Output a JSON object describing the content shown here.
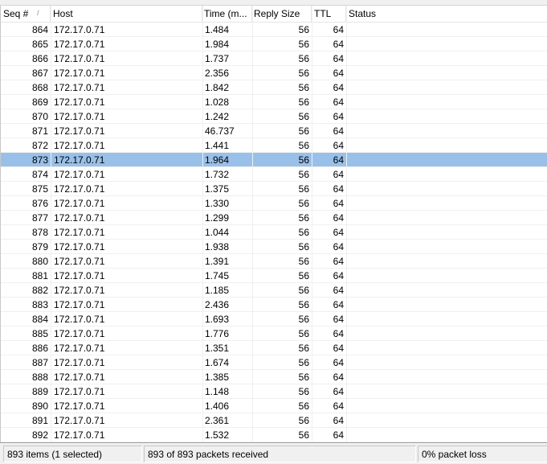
{
  "columns": {
    "seq": "Seq #",
    "sort_indicator": "/",
    "host": "Host",
    "time": "Time (m...",
    "reply_size": "Reply Size",
    "ttl": "TTL",
    "status": "Status"
  },
  "rows": [
    {
      "seq": "864",
      "host": "172.17.0.71",
      "time": "1.484",
      "size": "56",
      "ttl": "64",
      "status": ""
    },
    {
      "seq": "865",
      "host": "172.17.0.71",
      "time": "1.984",
      "size": "56",
      "ttl": "64",
      "status": ""
    },
    {
      "seq": "866",
      "host": "172.17.0.71",
      "time": "1.737",
      "size": "56",
      "ttl": "64",
      "status": ""
    },
    {
      "seq": "867",
      "host": "172.17.0.71",
      "time": "2.356",
      "size": "56",
      "ttl": "64",
      "status": ""
    },
    {
      "seq": "868",
      "host": "172.17.0.71",
      "time": "1.842",
      "size": "56",
      "ttl": "64",
      "status": ""
    },
    {
      "seq": "869",
      "host": "172.17.0.71",
      "time": "1.028",
      "size": "56",
      "ttl": "64",
      "status": ""
    },
    {
      "seq": "870",
      "host": "172.17.0.71",
      "time": "1.242",
      "size": "56",
      "ttl": "64",
      "status": ""
    },
    {
      "seq": "871",
      "host": "172.17.0.71",
      "time": "46.737",
      "size": "56",
      "ttl": "64",
      "status": ""
    },
    {
      "seq": "872",
      "host": "172.17.0.71",
      "time": "1.441",
      "size": "56",
      "ttl": "64",
      "status": ""
    },
    {
      "seq": "873",
      "host": "172.17.0.71",
      "time": "1.964",
      "size": "56",
      "ttl": "64",
      "status": "",
      "selected": true
    },
    {
      "seq": "874",
      "host": "172.17.0.71",
      "time": "1.732",
      "size": "56",
      "ttl": "64",
      "status": ""
    },
    {
      "seq": "875",
      "host": "172.17.0.71",
      "time": "1.375",
      "size": "56",
      "ttl": "64",
      "status": ""
    },
    {
      "seq": "876",
      "host": "172.17.0.71",
      "time": "1.330",
      "size": "56",
      "ttl": "64",
      "status": ""
    },
    {
      "seq": "877",
      "host": "172.17.0.71",
      "time": "1.299",
      "size": "56",
      "ttl": "64",
      "status": ""
    },
    {
      "seq": "878",
      "host": "172.17.0.71",
      "time": "1.044",
      "size": "56",
      "ttl": "64",
      "status": ""
    },
    {
      "seq": "879",
      "host": "172.17.0.71",
      "time": "1.938",
      "size": "56",
      "ttl": "64",
      "status": ""
    },
    {
      "seq": "880",
      "host": "172.17.0.71",
      "time": "1.391",
      "size": "56",
      "ttl": "64",
      "status": ""
    },
    {
      "seq": "881",
      "host": "172.17.0.71",
      "time": "1.745",
      "size": "56",
      "ttl": "64",
      "status": ""
    },
    {
      "seq": "882",
      "host": "172.17.0.71",
      "time": "1.185",
      "size": "56",
      "ttl": "64",
      "status": ""
    },
    {
      "seq": "883",
      "host": "172.17.0.71",
      "time": "2.436",
      "size": "56",
      "ttl": "64",
      "status": ""
    },
    {
      "seq": "884",
      "host": "172.17.0.71",
      "time": "1.693",
      "size": "56",
      "ttl": "64",
      "status": ""
    },
    {
      "seq": "885",
      "host": "172.17.0.71",
      "time": "1.776",
      "size": "56",
      "ttl": "64",
      "status": ""
    },
    {
      "seq": "886",
      "host": "172.17.0.71",
      "time": "1.351",
      "size": "56",
      "ttl": "64",
      "status": ""
    },
    {
      "seq": "887",
      "host": "172.17.0.71",
      "time": "1.674",
      "size": "56",
      "ttl": "64",
      "status": ""
    },
    {
      "seq": "888",
      "host": "172.17.0.71",
      "time": "1.385",
      "size": "56",
      "ttl": "64",
      "status": ""
    },
    {
      "seq": "889",
      "host": "172.17.0.71",
      "time": "1.148",
      "size": "56",
      "ttl": "64",
      "status": ""
    },
    {
      "seq": "890",
      "host": "172.17.0.71",
      "time": "1.406",
      "size": "56",
      "ttl": "64",
      "status": ""
    },
    {
      "seq": "891",
      "host": "172.17.0.71",
      "time": "2.361",
      "size": "56",
      "ttl": "64",
      "status": ""
    },
    {
      "seq": "892",
      "host": "172.17.0.71",
      "time": "1.532",
      "size": "56",
      "ttl": "64",
      "status": ""
    }
  ],
  "statusbar": {
    "items": "893 items (1 selected)",
    "packets": "893 of 893 packets received",
    "loss": "0% packet loss"
  },
  "colors": {
    "selected_row": "#99c0e9",
    "grid": "#f0f0f0",
    "statusbar_bg": "#f0f0f0"
  }
}
